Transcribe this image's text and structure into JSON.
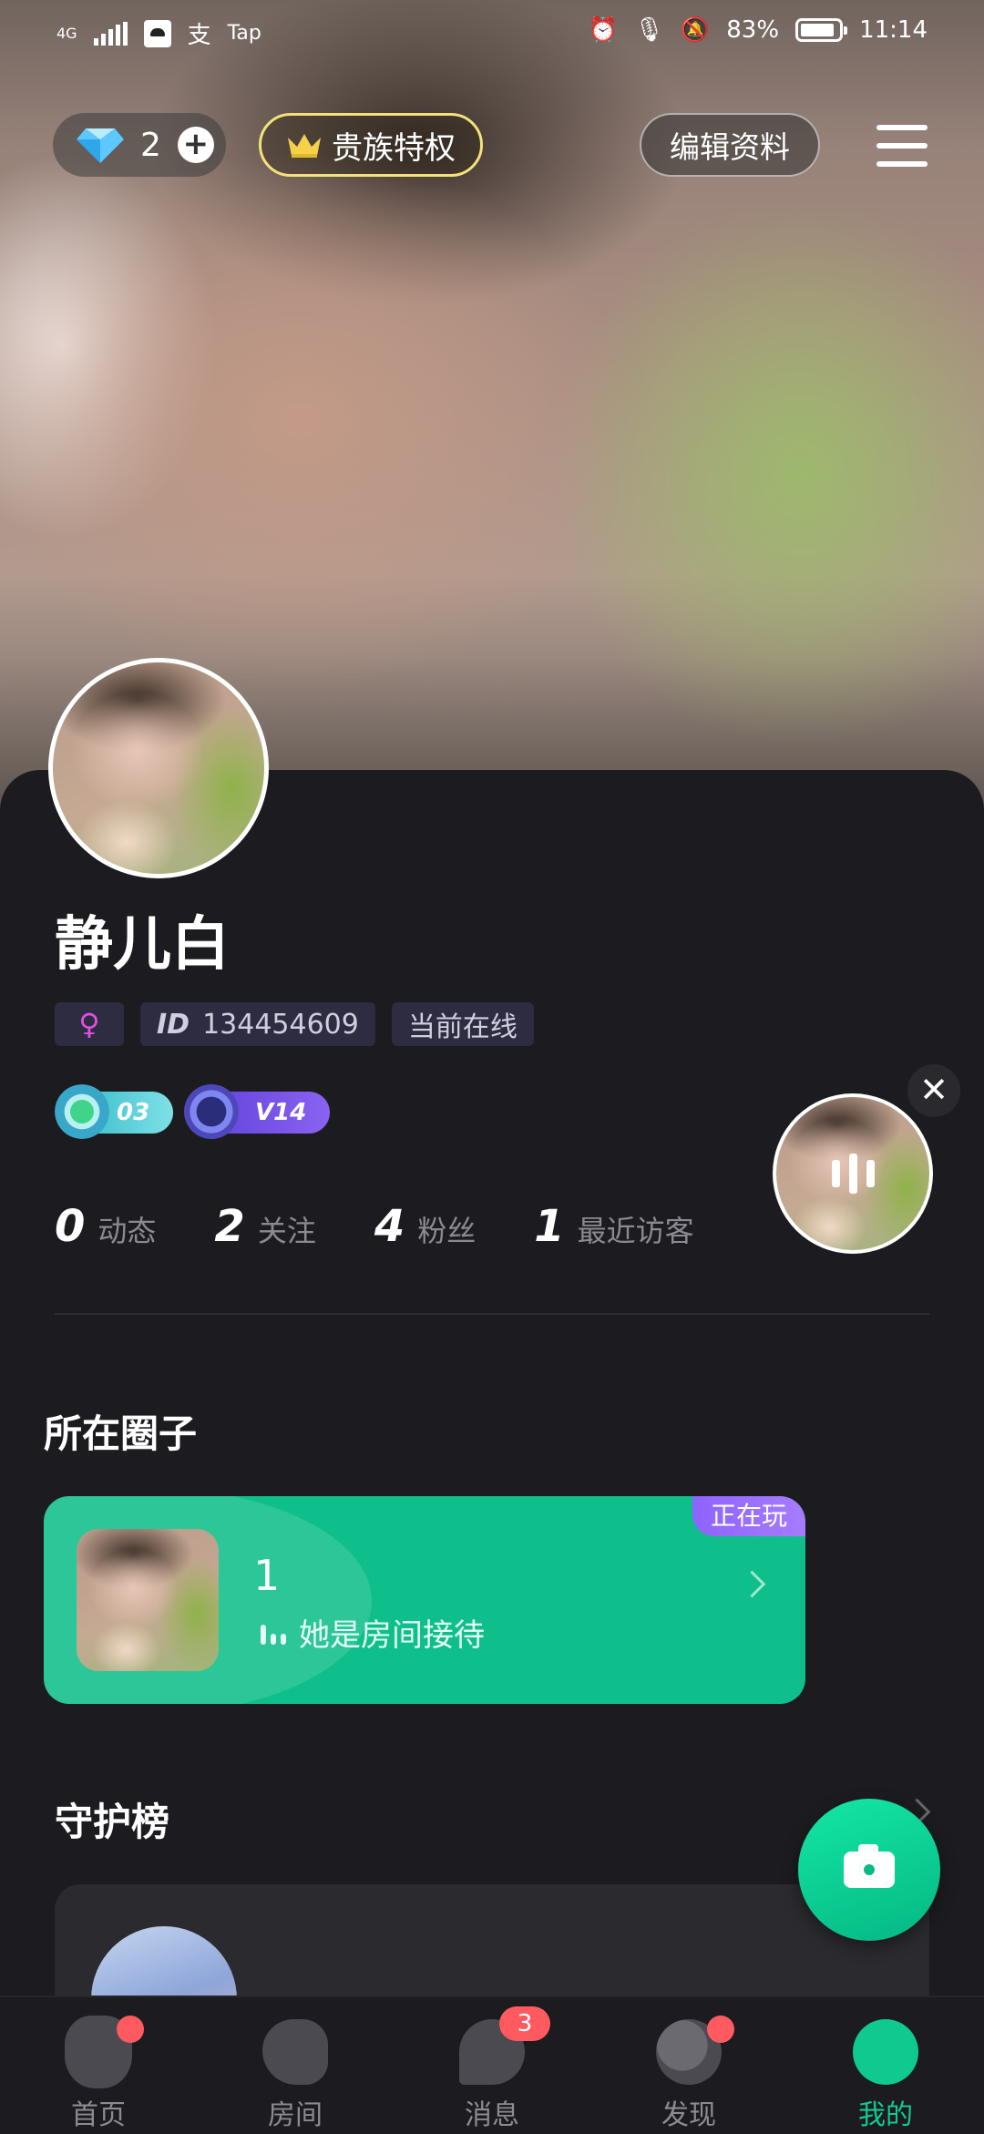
{
  "status_bar": {
    "network": "4G",
    "app_labels": [
      "支",
      "Tap"
    ],
    "battery": "83%",
    "time": "11:14"
  },
  "top_bar": {
    "diamond_count": "2",
    "noble_label": "贵族特权",
    "edit_label": "编辑资料"
  },
  "profile": {
    "name": "静儿白",
    "id_prefix": "ID",
    "id": "134454609",
    "online_status": "当前在线",
    "level_badge": "03",
    "vip_badge": "V14",
    "stats": [
      {
        "value": "0",
        "label": "动态"
      },
      {
        "value": "2",
        "label": "关注"
      },
      {
        "value": "4",
        "label": "粉丝"
      },
      {
        "value": "1",
        "label": "最近访客"
      }
    ]
  },
  "circle": {
    "title": "所在圈子",
    "room_number": "1",
    "role_text": "她是房间接待",
    "playing_tag": "正在玩"
  },
  "guard": {
    "title": "守护榜"
  },
  "float_player": {
    "close": "✕"
  },
  "bottom_nav": {
    "items": [
      {
        "label": "首页"
      },
      {
        "label": "房间"
      },
      {
        "label": "消息",
        "badge": "3"
      },
      {
        "label": "发现"
      },
      {
        "label": "我的"
      }
    ]
  },
  "colors": {
    "accent": "#12c990",
    "background": "#1c1c20",
    "badge_red": "#ff5a5f",
    "noble_border": "#f3e27a",
    "playing_tag": "#9a70ff"
  }
}
